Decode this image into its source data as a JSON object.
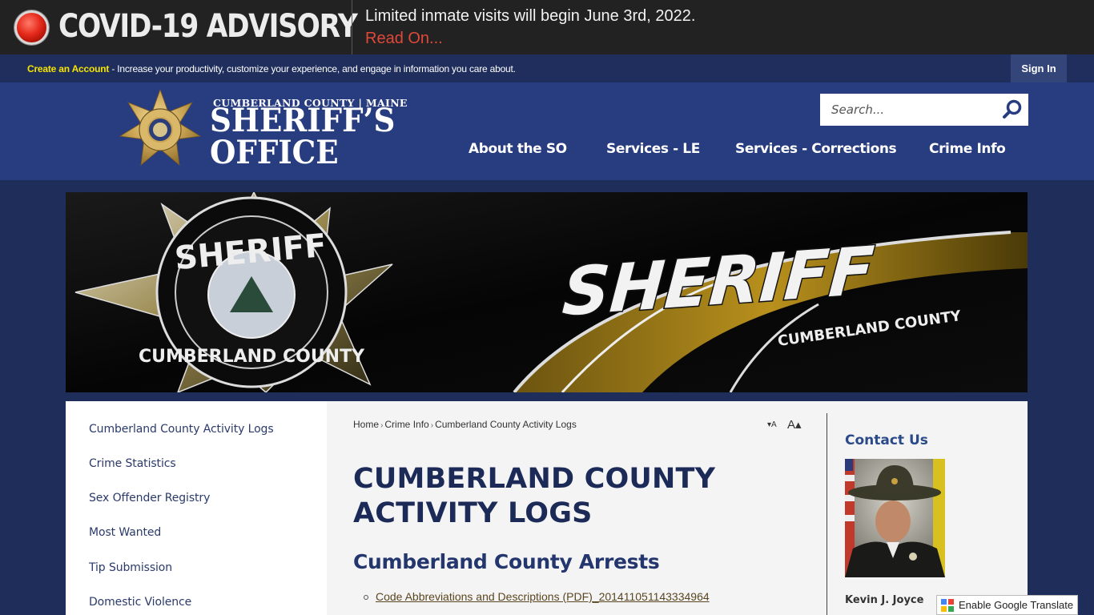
{
  "advisory": {
    "title": "COVID-19 ADVISORY",
    "message": "Limited inmate visits will begin June 3rd, 2022.",
    "link": "Read On...",
    "icon": "red-alert-dot-icon"
  },
  "account_bar": {
    "create_link": "Create an Account",
    "description": " - Increase your productivity, customize your experience, and engage in information you care about.",
    "sign_in": "Sign In"
  },
  "logo": {
    "line1": "CUMBERLAND COUNTY | MAINE",
    "line2": "SHERIFF’S",
    "line3": "OFFICE"
  },
  "search": {
    "placeholder": "Search...",
    "icon": "search-icon"
  },
  "nav": {
    "items": [
      {
        "label": "About the SO"
      },
      {
        "label": "Services - LE"
      },
      {
        "label": "Services - Corrections"
      },
      {
        "label": "Crime Info"
      }
    ]
  },
  "banner": {
    "badge_top": "SHERIFF",
    "badge_bottom": "CUMBERLAND COUNTY",
    "car_text": "SHERIFF",
    "car_subtext": "CUMBERLAND COUNTY"
  },
  "sidebar": {
    "items": [
      {
        "label": "Cumberland County Activity Logs"
      },
      {
        "label": "Crime Statistics"
      },
      {
        "label": "Sex Offender Registry"
      },
      {
        "label": "Most Wanted"
      },
      {
        "label": "Tip Submission"
      },
      {
        "label": "Domestic Violence"
      }
    ]
  },
  "breadcrumb": {
    "items": [
      "Home",
      "Crime Info",
      "Cumberland County Activity Logs"
    ],
    "separator": "›"
  },
  "font_size": {
    "decrease": "▾A",
    "increase": "A▴"
  },
  "main": {
    "title": "CUMBERLAND COUNTY ACTIVITY LOGS",
    "section_title": "Cumberland County Arrests",
    "documents": [
      {
        "label": "Code Abbreviations and Descriptions (PDF)_201411051143334964"
      }
    ]
  },
  "contact": {
    "title": "Contact Us",
    "name": "Kevin J. Joyce"
  },
  "translate": {
    "label": "Enable Google Translate"
  },
  "colors": {
    "advisory_bg": "#222222",
    "account_bar_bg": "#1f2e5c",
    "header_bg": "#283d80",
    "page_bg": "#1e2d5a",
    "accent_yellow": "#f5e400",
    "alert_red": "#e0483a",
    "title_navy": "#1b2a57"
  }
}
